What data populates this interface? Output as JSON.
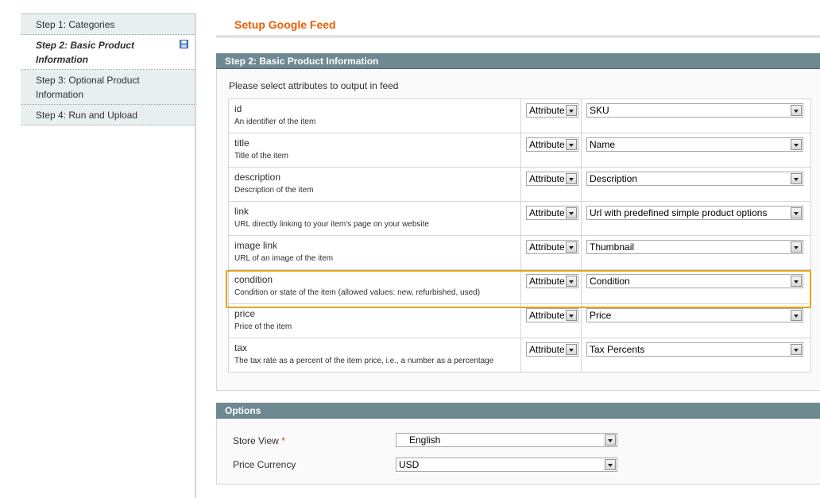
{
  "sidebar": {
    "items": [
      {
        "label": "Step 1: Categories"
      },
      {
        "label": "Step 2: Basic Product Information"
      },
      {
        "label": "Step 3: Optional Product Information"
      },
      {
        "label": "Step 4: Run and Upload"
      }
    ]
  },
  "page": {
    "title": "Setup Google Feed"
  },
  "step2": {
    "header": "Step 2: Basic Product Information",
    "instruction": "Please select attributes to output in feed",
    "rows": [
      {
        "name": "id",
        "desc": "An identifier of the item",
        "type": "Attribute",
        "value": "SKU"
      },
      {
        "name": "title",
        "desc": "Title of the item",
        "type": "Attribute",
        "value": "Name"
      },
      {
        "name": "description",
        "desc": "Description of the item",
        "type": "Attribute",
        "value": "Description"
      },
      {
        "name": "link",
        "desc": "URL directly linking to your item's page on your website",
        "type": "Attribute",
        "value": "Url with predefined simple product options"
      },
      {
        "name": "image link",
        "desc": "URL of an image of the item",
        "type": "Attribute",
        "value": "Thumbnail"
      },
      {
        "name": "condition",
        "desc": "Condition or state of the item (allowed values: new, refurbished, used)",
        "type": "Attribute",
        "value": "Condition"
      },
      {
        "name": "price",
        "desc": "Price of the item",
        "type": "Attribute",
        "value": "Price"
      },
      {
        "name": "tax",
        "desc": "The tax rate as a percent of the item price, i.e., a number as a percentage",
        "type": "Attribute",
        "value": "Tax Percents"
      }
    ]
  },
  "options": {
    "header": "Options",
    "store_view_label": "Store View",
    "required_mark": "*",
    "store_view_value": "English",
    "price_currency_label": "Price Currency",
    "price_currency_value": "USD"
  },
  "colors": {
    "title": "#eb5e00",
    "section_header_bg": "#6f8992",
    "highlight": "#e2a51e",
    "required": "#eb340a"
  }
}
